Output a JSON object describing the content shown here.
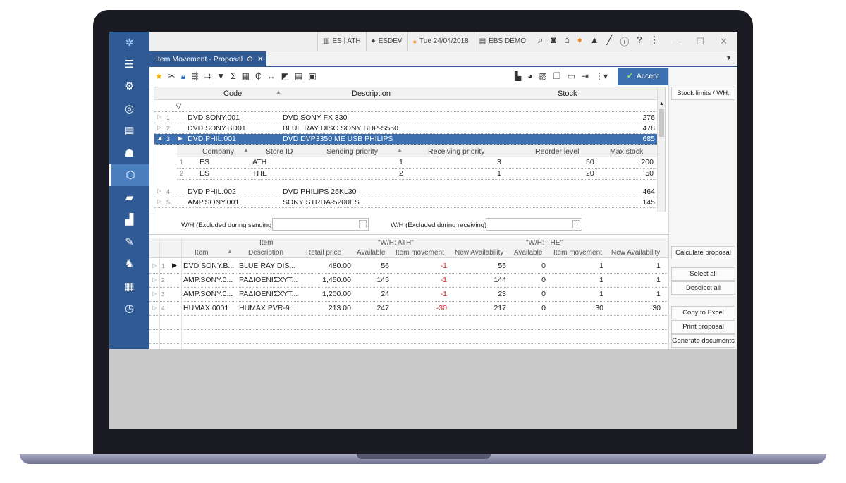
{
  "titlebar": {
    "company": "ES | ATH",
    "user": "ESDEV",
    "date": "Tue 24/04/2018",
    "db": "EBS DEMO"
  },
  "tab": {
    "label": "Item Movement - Proposal",
    "pin": "⊕",
    "close": "✕"
  },
  "toolbar": {
    "accept_label": "Accept"
  },
  "side_buttons": {
    "stock_limits": "Stock limits / WH.",
    "calc": "Calculate proposal",
    "select_all": "Select all",
    "deselect_all": "Deselect all",
    "copy_excel": "Copy to Excel",
    "print": "Print proposal",
    "generate": "Generate documents"
  },
  "grid1": {
    "headers": {
      "code": "Code",
      "description": "Description",
      "stock": "Stock"
    },
    "rows": [
      {
        "num": "1",
        "code": "DVD.SONY.001",
        "desc": "DVD SONY FX 330",
        "stock": "276"
      },
      {
        "num": "2",
        "code": "DVD.SONY.BD01",
        "desc": "BLUE RAY DISC SONY BDP-S550",
        "stock": "478"
      },
      {
        "num": "3",
        "code": "DVD.PHIL.001",
        "desc": "DVD DVP3350 ME USB PHILIPS",
        "stock": "685"
      },
      {
        "num": "4",
        "code": "DVD.PHIL.002",
        "desc": "DVD PHILIPS 25KL30",
        "stock": "464"
      },
      {
        "num": "5",
        "code": "AMP.SONY.001",
        "desc": "SONY STRDA-5200ES",
        "stock": "145"
      }
    ],
    "sub_headers": {
      "company": "Company",
      "store": "Store ID",
      "sending": "Sending priority",
      "receiving": "Receiving priority",
      "reorder": "Reorder level",
      "max": "Max stock"
    },
    "sub_rows": [
      {
        "num": "1",
        "company": "ES",
        "store": "ATH",
        "sending": "1",
        "receiving": "3",
        "reorder": "50",
        "max": "200"
      },
      {
        "num": "2",
        "company": "ES",
        "store": "THE",
        "sending": "2",
        "receiving": "1",
        "reorder": "20",
        "max": "50"
      }
    ]
  },
  "whbar": {
    "sending_label": "W/H (Excluded during sending)",
    "receiving_label": "W/H (Excluded during receiving)",
    "ellipsis": "···"
  },
  "grid2": {
    "groups": {
      "item": "Item",
      "ath": "\"W/H: ATH\"",
      "the": "\"W/H: THE\""
    },
    "headers": {
      "item": "Item",
      "desc": "Description",
      "price": "Retail price",
      "avail": "Available",
      "move": "Item movement",
      "newavail": "New Availability",
      "avail2": "Available",
      "move2": "Item movement",
      "newavail2": "New Availability"
    },
    "rows": [
      {
        "num": "1",
        "item": "DVD.SONY.B...",
        "desc": "BLUE RAY DIS...",
        "price": "480.00",
        "avail": "56",
        "move": "-1",
        "newavail": "55",
        "avail2": "0",
        "move2": "1",
        "newavail2": "1"
      },
      {
        "num": "2",
        "item": "AMP.SONY.0...",
        "desc": "ΡΑΔΙΟΕΝΙΣΧΥΤ...",
        "price": "1,450.00",
        "avail": "145",
        "move": "-1",
        "newavail": "144",
        "avail2": "0",
        "move2": "1",
        "newavail2": "1"
      },
      {
        "num": "3",
        "item": "AMP.SONY.0...",
        "desc": "ΡΑΔΙΟΕΝΙΣΧΥΤ...",
        "price": "1,200.00",
        "avail": "24",
        "move": "-1",
        "newavail": "23",
        "avail2": "0",
        "move2": "1",
        "newavail2": "1"
      },
      {
        "num": "4",
        "item": "HUMAX.0001",
        "desc": "HUMAX PVR-9...",
        "price": "213.00",
        "avail": "247",
        "move": "-30",
        "newavail": "217",
        "avail2": "0",
        "move2": "30",
        "newavail2": "30"
      }
    ]
  },
  "colors": {
    "sidebar": "#2f5a94",
    "accent": "#3a6fb0",
    "negative": "#d62424"
  },
  "icons": {
    "sidebar": [
      "hamburger-icon",
      "settings-icon",
      "target-icon",
      "ledger-icon",
      "users-icon",
      "box-icon",
      "truck-icon",
      "warehouse-icon",
      "edit-icon",
      "bag-icon",
      "chart-icon",
      "clock-icon"
    ]
  }
}
